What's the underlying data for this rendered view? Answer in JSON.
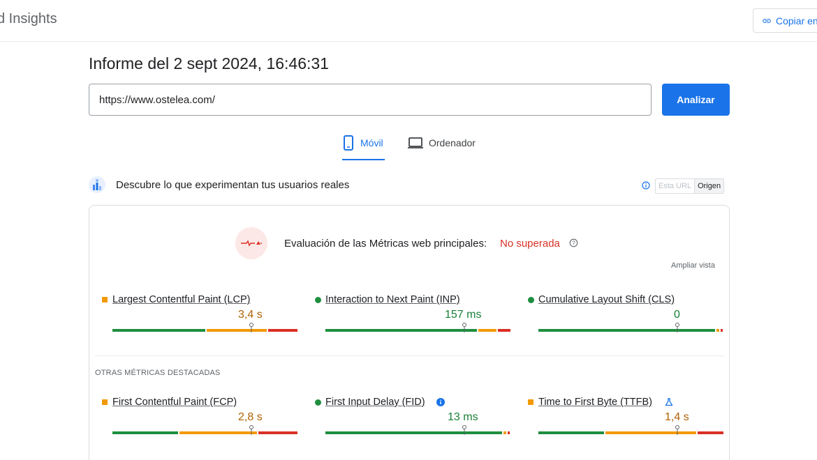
{
  "header": {
    "app_title": "d Insights",
    "copy_label": "Copiar en"
  },
  "report": {
    "title": "Informe del 2 sept 2024, 16:46:31"
  },
  "search": {
    "url_value": "https://www.ostelea.com/",
    "analyze_label": "Analizar"
  },
  "tabs": [
    {
      "label": "Móvil",
      "icon": "smartphone-icon",
      "selected": true
    },
    {
      "label": "Ordenador",
      "icon": "laptop-icon",
      "selected": false
    }
  ],
  "crux": {
    "heading": "Descubre lo que experimentan tus usuarios reales",
    "toggle_url": "Esta URL",
    "toggle_origin": "Origen",
    "selected": "Origen"
  },
  "assessment": {
    "label": "Evaluación de las Métricas web principales:",
    "result": "No superada",
    "expand_label": "Ampliar vista"
  },
  "core_metrics": [
    {
      "name": "Largest Contentful Paint (LCP)",
      "value": "3,4 s",
      "status": "needs-improvement",
      "segments": [
        0.5,
        0.33,
        0.17
      ],
      "marker": 0.75
    },
    {
      "name": "Interaction to Next Paint (INP)",
      "value": "157 ms",
      "status": "good",
      "segments": [
        0.83,
        0.1,
        0.07
      ],
      "marker": 0.75
    },
    {
      "name": "Cumulative Layout Shift (CLS)",
      "value": "0",
      "status": "good",
      "segments": [
        0.96,
        0.02,
        0.02
      ],
      "marker": 0.75
    }
  ],
  "other_section_label": "OTRAS MÉTRICAS DESTACADAS",
  "other_metrics": [
    {
      "name": "First Contentful Paint (FCP)",
      "value": "2,8 s",
      "status": "needs-improvement",
      "segments": [
        0.36,
        0.42,
        0.22
      ],
      "marker": 0.75
    },
    {
      "name": "First Input Delay (FID)",
      "value": "13 ms",
      "status": "good",
      "extra_icon": "info-icon",
      "segments": [
        0.96,
        0.02,
        0.02
      ],
      "marker": 0.75
    },
    {
      "name": "Time to First Byte (TTFB)",
      "value": "1,4 s",
      "status": "needs-improvement",
      "extra_icon": "flask-icon",
      "segments": [
        0.36,
        0.5,
        0.14
      ],
      "marker": 0.75
    }
  ],
  "colors": {
    "accent": "#1a73e8",
    "good": "#1e8e3e",
    "needs_improvement": "#f29900",
    "poor": "#d93025"
  }
}
